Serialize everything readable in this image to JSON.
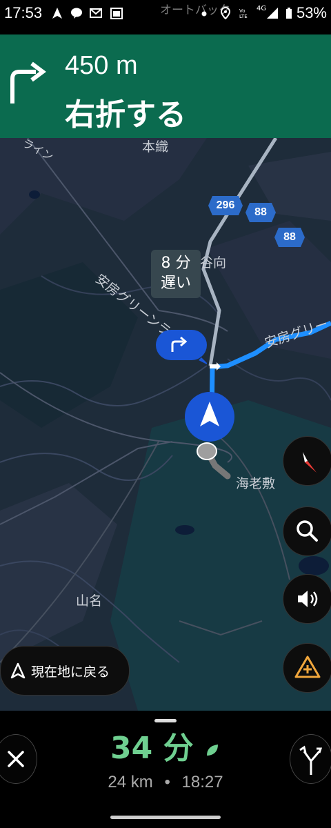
{
  "status_bar": {
    "time": "17:53",
    "ticker": "オートバックス 館山バイパ",
    "network": "4G",
    "battery": "53%"
  },
  "nav_banner": {
    "maneuver_icon": "turn-right-icon",
    "distance": "450 m",
    "instruction": "右折する"
  },
  "map": {
    "labels": {
      "honori": "本織",
      "yamana": "山名",
      "ebishiki": "海老敷",
      "yatsumuki": "谷向",
      "awa_green_line_1": "安房グリーンライン",
      "awa_green_line_2": "安房グリー",
      "line_fragment": "ライン"
    },
    "route_shields": [
      "296",
      "88",
      "88"
    ],
    "delay": {
      "minutes": "8 分",
      "label": "遅い"
    },
    "next_turn_icon": "turn-right-icon"
  },
  "map_controls": {
    "compass": "compass-icon",
    "search": "search-icon",
    "sound": "volume-icon",
    "report": "report-incident-icon",
    "recenter_label": "現在地に戻る"
  },
  "trip": {
    "eta_minutes": "34 分",
    "distance": "24 km",
    "arrival": "18:27",
    "separator": "•"
  },
  "colors": {
    "banner": "#0b6b4f",
    "route": "#1e8fff",
    "eta_green": "#6fcf90"
  }
}
